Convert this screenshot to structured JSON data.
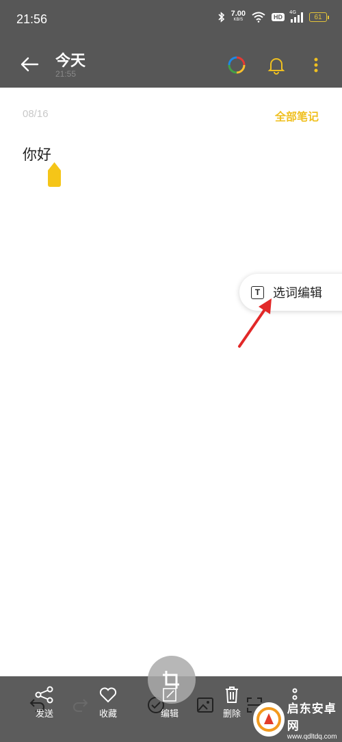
{
  "status_bar": {
    "time": "21:56",
    "net_speed_value": "7.00",
    "net_speed_unit": "KB/S",
    "hd_badge": "HD",
    "signal_label": "4G",
    "battery_level": "61"
  },
  "header": {
    "title": "今天",
    "subtitle": "21:55"
  },
  "note": {
    "date": "08/16",
    "all_notes_label": "全部笔记",
    "text": "你好"
  },
  "popup": {
    "label": "选词编辑",
    "icon_glyph": "T"
  },
  "toolbar": {
    "send_label": "发送",
    "favorite_label": "收藏",
    "edit_label": "编辑",
    "delete_label": "删除"
  },
  "watermark": {
    "name": "启东安卓网",
    "url": "www.qdltdq.com"
  },
  "colors": {
    "accent_yellow": "#f0c020",
    "header_gray": "#575757",
    "arrow_red": "#e22828"
  }
}
